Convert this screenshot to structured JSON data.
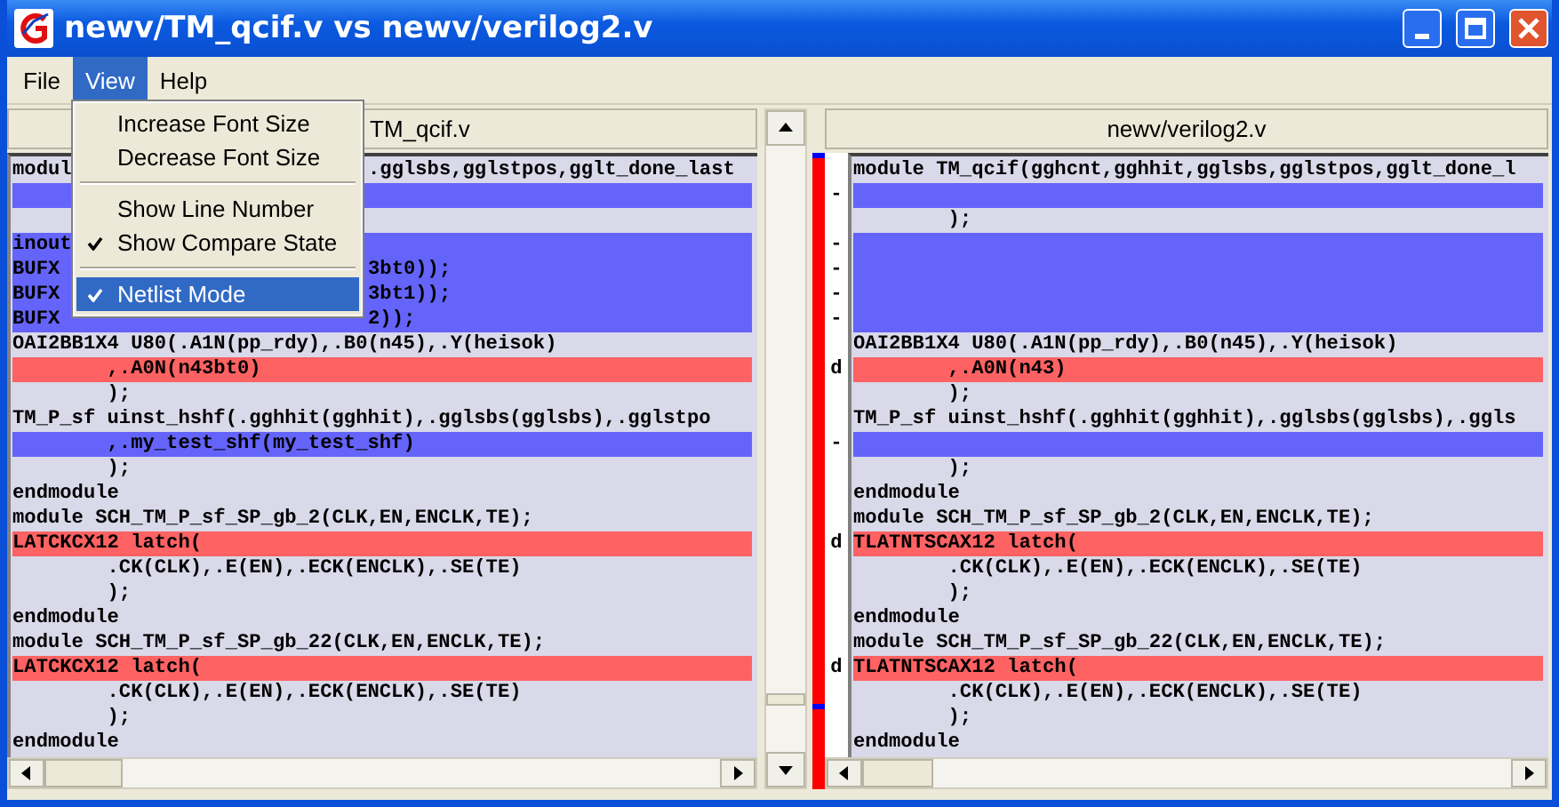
{
  "window": {
    "title": "newv/TM_qcif.v vs newv/verilog2.v"
  },
  "menu_bar": [
    {
      "label": "File",
      "selected": false
    },
    {
      "label": "View",
      "selected": true
    },
    {
      "label": "Help",
      "selected": false
    }
  ],
  "view_menu": [
    {
      "kind": "item",
      "label": "Increase Font Size",
      "checked": false,
      "selected": false
    },
    {
      "kind": "item",
      "label": "Decrease Font Size",
      "checked": false,
      "selected": false
    },
    {
      "kind": "separator"
    },
    {
      "kind": "item",
      "label": "Show Line Number",
      "checked": false,
      "selected": false
    },
    {
      "kind": "item",
      "label": "Show Compare State",
      "checked": true,
      "selected": false
    },
    {
      "kind": "separator"
    },
    {
      "kind": "item",
      "label": "Netlist Mode",
      "checked": true,
      "selected": true
    }
  ],
  "left_pane": {
    "header": "TM_qcif.v",
    "lines": [
      {
        "kind": "same",
        "text": "modul",
        "text_after_menu": ".gglsbs,gglstpos,gglt_done_last"
      },
      {
        "kind": "inserted"
      },
      {
        "kind": "same"
      },
      {
        "kind": "inserted",
        "text": "inout"
      },
      {
        "kind": "inserted",
        "text": "BUFX",
        "text_after_menu": "3bt0));"
      },
      {
        "kind": "inserted",
        "text": "BUFX",
        "text_after_menu": "3bt1));"
      },
      {
        "kind": "inserted",
        "text": "BUFX",
        "text_after_menu": "2));"
      },
      {
        "kind": "same",
        "text": "OAI2BB1X4 U80(.A1N(pp_rdy),.B0(n45),.Y(heisok)"
      },
      {
        "kind": "changed",
        "text": "        ,.A0N(n43bt0)"
      },
      {
        "kind": "same",
        "text": "        );"
      },
      {
        "kind": "same",
        "text": "TM_P_sf uinst_hshf(.gghhit(gghhit),.gglsbs(gglsbs),.gglstpo"
      },
      {
        "kind": "inserted",
        "text": "        ,.my_test_shf(my_test_shf)"
      },
      {
        "kind": "same",
        "text": "        );"
      },
      {
        "kind": "same",
        "text": "endmodule"
      },
      {
        "kind": "same",
        "text": "module SCH_TM_P_sf_SP_gb_2(CLK,EN,ENCLK,TE);"
      },
      {
        "kind": "changed",
        "text": "LATCKCX12 latch("
      },
      {
        "kind": "same",
        "text": "        .CK(CLK),.E(EN),.ECK(ENCLK),.SE(TE)"
      },
      {
        "kind": "same",
        "text": "        );"
      },
      {
        "kind": "same",
        "text": "endmodule"
      },
      {
        "kind": "same",
        "text": "module SCH_TM_P_sf_SP_gb_22(CLK,EN,ENCLK,TE);"
      },
      {
        "kind": "changed",
        "text": "LATCKCX12 latch("
      },
      {
        "kind": "same",
        "text": "        .CK(CLK),.E(EN),.ECK(ENCLK),.SE(TE)"
      },
      {
        "kind": "same",
        "text": "        );"
      },
      {
        "kind": "same",
        "text": "endmodule"
      }
    ]
  },
  "right_pane": {
    "header": "newv/verilog2.v",
    "lines": [
      {
        "kind": "same",
        "text": "module TM_qcif(gghcnt,gghhit,gglsbs,gglstpos,gglt_done_l"
      },
      {
        "kind": "inserted",
        "marker": "-"
      },
      {
        "kind": "same",
        "text": "        );"
      },
      {
        "kind": "inserted",
        "marker": "-"
      },
      {
        "kind": "inserted",
        "marker": "-"
      },
      {
        "kind": "inserted",
        "marker": "-"
      },
      {
        "kind": "inserted",
        "marker": "-"
      },
      {
        "kind": "same",
        "text": "OAI2BB1X4 U80(.A1N(pp_rdy),.B0(n45),.Y(heisok)"
      },
      {
        "kind": "changed",
        "marker": "d",
        "text": "        ,.A0N(n43)"
      },
      {
        "kind": "same",
        "text": "        );"
      },
      {
        "kind": "same",
        "text": "TM_P_sf uinst_hshf(.gghhit(gghhit),.gglsbs(gglsbs),.ggls"
      },
      {
        "kind": "inserted",
        "marker": "-"
      },
      {
        "kind": "same",
        "text": "        );"
      },
      {
        "kind": "same",
        "text": "endmodule"
      },
      {
        "kind": "same",
        "text": "module SCH_TM_P_sf_SP_gb_2(CLK,EN,ENCLK,TE);"
      },
      {
        "kind": "changed",
        "marker": "d",
        "text": "TLATNTSCAX12 latch("
      },
      {
        "kind": "same",
        "text": "        .CK(CLK),.E(EN),.ECK(ENCLK),.SE(TE)"
      },
      {
        "kind": "same",
        "text": "        );"
      },
      {
        "kind": "same",
        "text": "endmodule"
      },
      {
        "kind": "same",
        "text": "module SCH_TM_P_sf_SP_gb_22(CLK,EN,ENCLK,TE);"
      },
      {
        "kind": "changed",
        "marker": "d",
        "text": "TLATNTSCAX12 latch("
      },
      {
        "kind": "same",
        "text": "        .CK(CLK),.E(EN),.ECK(ENCLK),.SE(TE)"
      },
      {
        "kind": "same",
        "text": "        );"
      },
      {
        "kind": "same",
        "text": "endmodule"
      }
    ]
  }
}
